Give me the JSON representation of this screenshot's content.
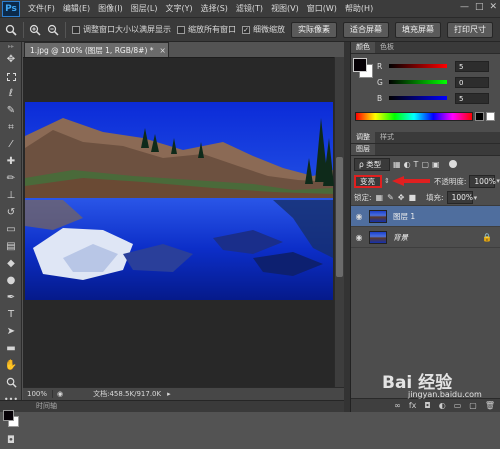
{
  "app": {
    "logo": "Ps"
  },
  "menu": [
    "文件(F)",
    "编辑(E)",
    "图像(I)",
    "图层(L)",
    "文字(Y)",
    "选择(S)",
    "滤镜(T)",
    "视图(V)",
    "窗口(W)",
    "帮助(H)"
  ],
  "window_controls": [
    "—",
    "□",
    "✕"
  ],
  "options": {
    "checkbox_resize": "调整窗口大小以满屏显示",
    "checkbox_zoom_all": "缩放所有窗口",
    "checkbox_scrubby": "细微缩放",
    "scrubby_checked": "✓",
    "btn_actual": "实际像素",
    "btn_fit": "适合屏幕",
    "btn_fill": "填充屏幕",
    "btn_print": "打印尺寸"
  },
  "document": {
    "tab_title": "1.jpg @ 100% (图层 1, RGB/8#) *",
    "tab_close": "×",
    "zoom": "100%",
    "doc_info": "文档:458.5K/917.0K"
  },
  "timeline_label": "时间轴",
  "color_panel": {
    "tab_active": "颜色",
    "tab_other": "色板",
    "r_label": "R",
    "g_label": "G",
    "b_label": "B",
    "r_value": "5",
    "g_value": "0",
    "b_value": "5"
  },
  "adjust_panel": {
    "tab_active": "调整",
    "tab_other": "样式"
  },
  "layers_panel": {
    "tab_label": "图层",
    "kind_label": "ρ 类型",
    "blend_mode": "变亮",
    "opacity_label": "不透明度:",
    "opacity_value": "100%",
    "lock_label": "锁定:",
    "fill_label": "填充:",
    "fill_value": "100%",
    "layers": [
      {
        "name": "图层 1",
        "selected": true
      },
      {
        "name": "背景",
        "selected": false
      }
    ]
  },
  "watermark": {
    "brand": "Bai 经验",
    "url": "jingyan.baidu.com"
  },
  "colors": {
    "accent_red": "#e02020",
    "selected_layer": "#4f6e9e"
  }
}
